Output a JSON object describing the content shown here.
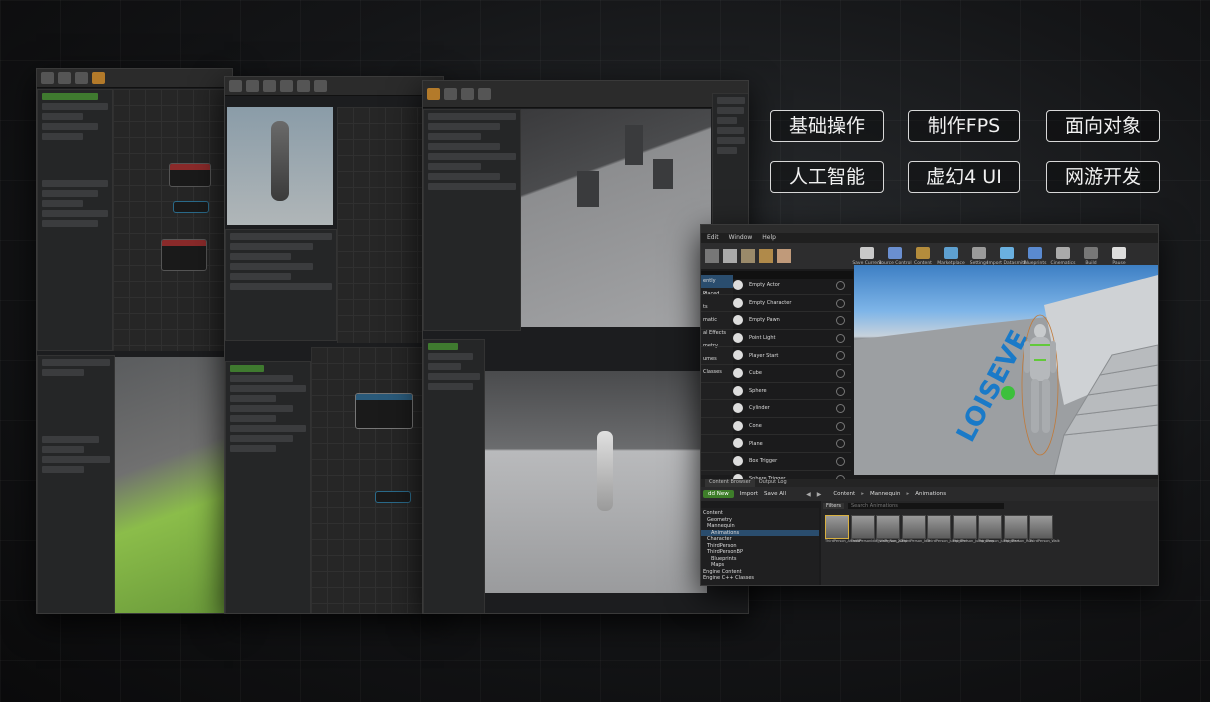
{
  "tags": [
    "基础操作",
    "制作FPS",
    "面向对象",
    "人工智能",
    "虚幻4 UI",
    "网游开发"
  ],
  "editor": {
    "menu": [
      "Edit",
      "Window",
      "Help"
    ],
    "toolbar": [
      {
        "label": "Save Current",
        "icon": "save-icon",
        "color": "#c9c9c9"
      },
      {
        "label": "Source Control",
        "icon": "source-control-icon",
        "color": "#6a8fd0"
      },
      {
        "label": "Content",
        "icon": "content-icon",
        "color": "#b48c3c"
      },
      {
        "label": "Marketplace",
        "icon": "marketplace-icon",
        "color": "#5ea0d0"
      },
      {
        "label": "Settings",
        "icon": "gear-icon",
        "color": "#9a9a9a"
      },
      {
        "label": "Import Datasmith",
        "icon": "datasmith-icon",
        "color": "#6ab0e0"
      },
      {
        "label": "Blueprints",
        "icon": "blueprint-icon",
        "color": "#5a8ad0"
      },
      {
        "label": "Cinematics",
        "icon": "film-icon",
        "color": "#aaaaaa"
      },
      {
        "label": "Build",
        "icon": "build-icon",
        "color": "#777777"
      },
      {
        "label": "Pause",
        "icon": "pause-icon",
        "color": "#dddddd"
      }
    ],
    "modes_header": "ently Placed",
    "place_items": [
      "Empty Actor",
      "Empty Character",
      "Empty Pawn",
      "Point Light",
      "Player Start",
      "Cube",
      "Sphere",
      "Cylinder",
      "Cone",
      "Plane",
      "Box Trigger",
      "Sphere Trigger"
    ],
    "categories": [
      "ently Placed",
      "ic",
      "ts",
      "matic",
      "al Effects",
      "metry",
      "umes",
      "Classes"
    ],
    "content_tabs": [
      "Content Browser",
      "Output Log"
    ],
    "add_new": "dd New",
    "import": "Import",
    "save_all": "Save All",
    "breadcrumb": [
      "Content",
      "Mannequin",
      "Animations"
    ],
    "filters": "Filters",
    "search_placeholder": "Search Animations",
    "tree": [
      "Content",
      "Geometry",
      "Mannequin",
      "Animations",
      "Character",
      "ThirdPerson",
      "ThirdPersonBP",
      "Blueprints",
      "Maps",
      "Engine Content",
      "Engine C++ Classes"
    ],
    "assets": [
      "ThirdPerson_AnimBP",
      "ThirdPersonIdle_Walk_Run_2D",
      "ThirdPerson_Jump",
      "ThirdPerson_Idle",
      "ThirdPerson_Jump_End",
      "ThirdPerson_Jump_Loop",
      "ThirdPerson_Jump_Start",
      "ThirdPerson_Run",
      "ThirdPerson_Walk"
    ]
  }
}
